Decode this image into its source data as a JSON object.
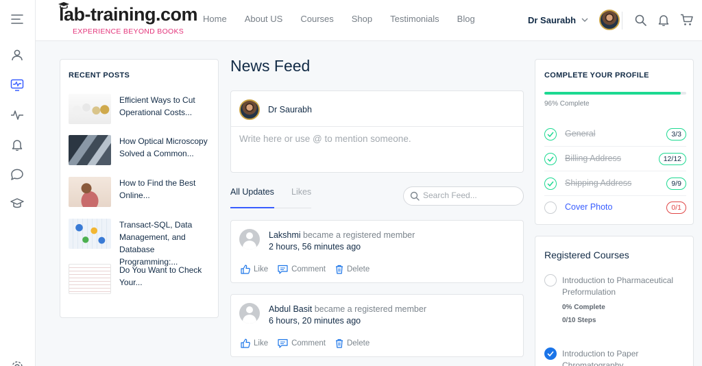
{
  "header": {
    "logo_text": "lab-training",
    "logo_suffix": ".com",
    "tagline": "EXPERIENCE BEYOND BOOKS",
    "nav": [
      "Home",
      "About US",
      "Courses",
      "Shop",
      "Testimonials",
      "Blog"
    ],
    "user_name": "Dr Saurabh"
  },
  "recent_posts": {
    "title": "RECENT POSTS",
    "items": [
      {
        "title": "Efficient Ways to Cut Operational Costs..."
      },
      {
        "title": "How Optical Microscopy Solved a Common..."
      },
      {
        "title": "How to Find the Best Online..."
      },
      {
        "title": "Transact-SQL, Data Management, and Database Programming:..."
      },
      {
        "title": "Do You Want to Check Your..."
      }
    ]
  },
  "feed": {
    "title": "News Feed",
    "composer_name": "Dr Saurabh",
    "composer_placeholder": "Write here or use @ to mention someone.",
    "tabs": [
      "All Updates",
      "Likes"
    ],
    "search_placeholder": "Search Feed...",
    "activities": [
      {
        "who": "Lakshmi",
        "what": "became a registered member",
        "time": "2 hours, 56 minutes ago"
      },
      {
        "who": "Abdul Basit",
        "what": "became a registered member",
        "time": "6 hours, 20 minutes ago"
      }
    ],
    "actions": [
      "Like",
      "Comment",
      "Delete"
    ]
  },
  "profile": {
    "title": "COMPLETE YOUR PROFILE",
    "progress_pct": 96,
    "progress_text": "96% Complete",
    "rows": [
      {
        "label": "General",
        "badge": "3/3",
        "done": true
      },
      {
        "label": "Billing Address",
        "badge": "12/12",
        "done": true
      },
      {
        "label": "Shipping Address",
        "badge": "9/9",
        "done": true
      },
      {
        "label": "Cover Photo",
        "badge": "0/1",
        "done": false
      }
    ]
  },
  "courses": {
    "title": "Registered Courses",
    "items": [
      {
        "name": "Introduction to Pharmaceutical Preformulation",
        "complete": "0% Complete",
        "steps": "0/10 Steps",
        "done": false
      },
      {
        "name": "Introduction to Paper Chromatography",
        "done": true
      }
    ]
  },
  "icons": {
    "sidebar": [
      "menu-icon",
      "profile-icon",
      "activity-feed-icon",
      "pulse-icon",
      "bell-icon",
      "chat-icon",
      "graduation-cap-icon",
      "settings-icon"
    ],
    "header": [
      "search-icon",
      "bell-icon",
      "cart-icon"
    ]
  },
  "colors": {
    "accent": "#385dff",
    "success": "#1cd991",
    "danger": "#e04646",
    "brand_pink": "#e3347a"
  }
}
